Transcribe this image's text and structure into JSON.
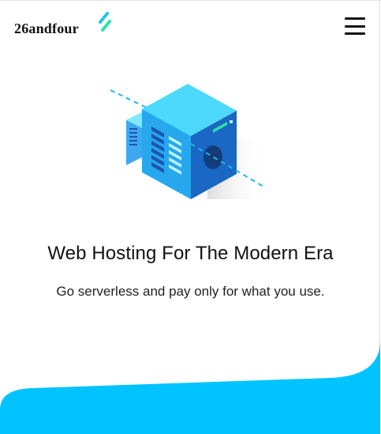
{
  "header": {
    "brand_name": "26andfour",
    "logo_icon": "lightning-bolt-icon",
    "menu_icon": "hamburger-menu-icon"
  },
  "hero": {
    "illustration": "server-cube-illustration",
    "title": "Web Hosting For The Modern Era",
    "subtitle": "Go serverless and pay only for what you use."
  },
  "colors": {
    "accent": "#00c3ff",
    "accent_light": "#4de8ff",
    "brand_green": "#2de0a7",
    "server_dark": "#1565c0",
    "text": "#111111"
  }
}
